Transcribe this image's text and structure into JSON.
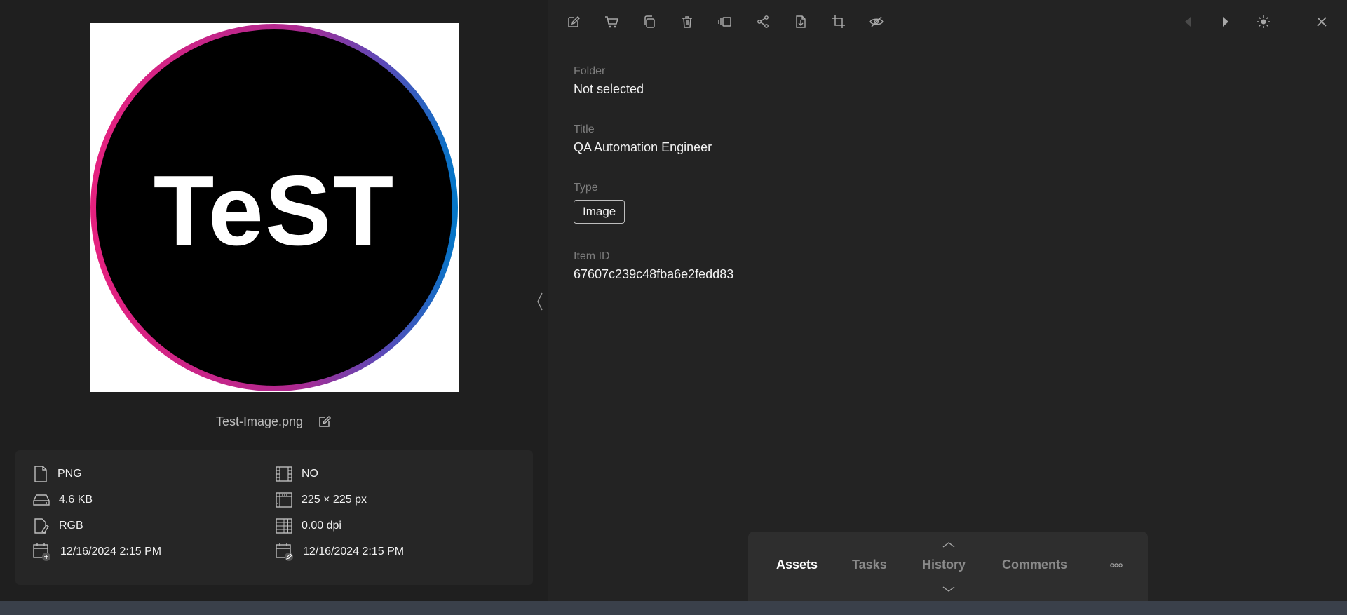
{
  "preview": {
    "logo_text": "TeST",
    "ring_colors": [
      "#e6217f",
      "#8a3fb0",
      "#0070c0"
    ]
  },
  "file": {
    "name": "Test-Image.png"
  },
  "metadata": {
    "format": "PNG",
    "size": "4.6 KB",
    "color_mode": "RGB",
    "created": "12/16/2024 2:15 PM",
    "video": "NO",
    "dimensions": "225 × 225 px",
    "resolution": "0.00 dpi",
    "modified": "12/16/2024 2:15 PM"
  },
  "details": {
    "folder_label": "Folder",
    "folder_value": "Not selected",
    "title_label": "Title",
    "title_value": "QA Automation Engineer",
    "type_label": "Type",
    "type_value": "Image",
    "item_id_label": "Item ID",
    "item_id_value": "67607c239c48fba6e2fedd83"
  },
  "toolbar": {
    "icons": [
      "edit-icon",
      "cart-icon",
      "copy-icon",
      "trash-icon",
      "compare-icon",
      "share-icon",
      "download-icon",
      "crop-icon",
      "hide-icon",
      "prev-icon",
      "next-icon",
      "brightness-icon",
      "close-icon"
    ]
  },
  "tabs": {
    "assets": "Assets",
    "tasks": "Tasks",
    "history": "History",
    "comments": "Comments",
    "active": "Assets"
  },
  "colors": {
    "background": "#1c1c1c",
    "panel": "#232323",
    "text": "#f2f2f2",
    "muted": "#7d7d7d"
  }
}
